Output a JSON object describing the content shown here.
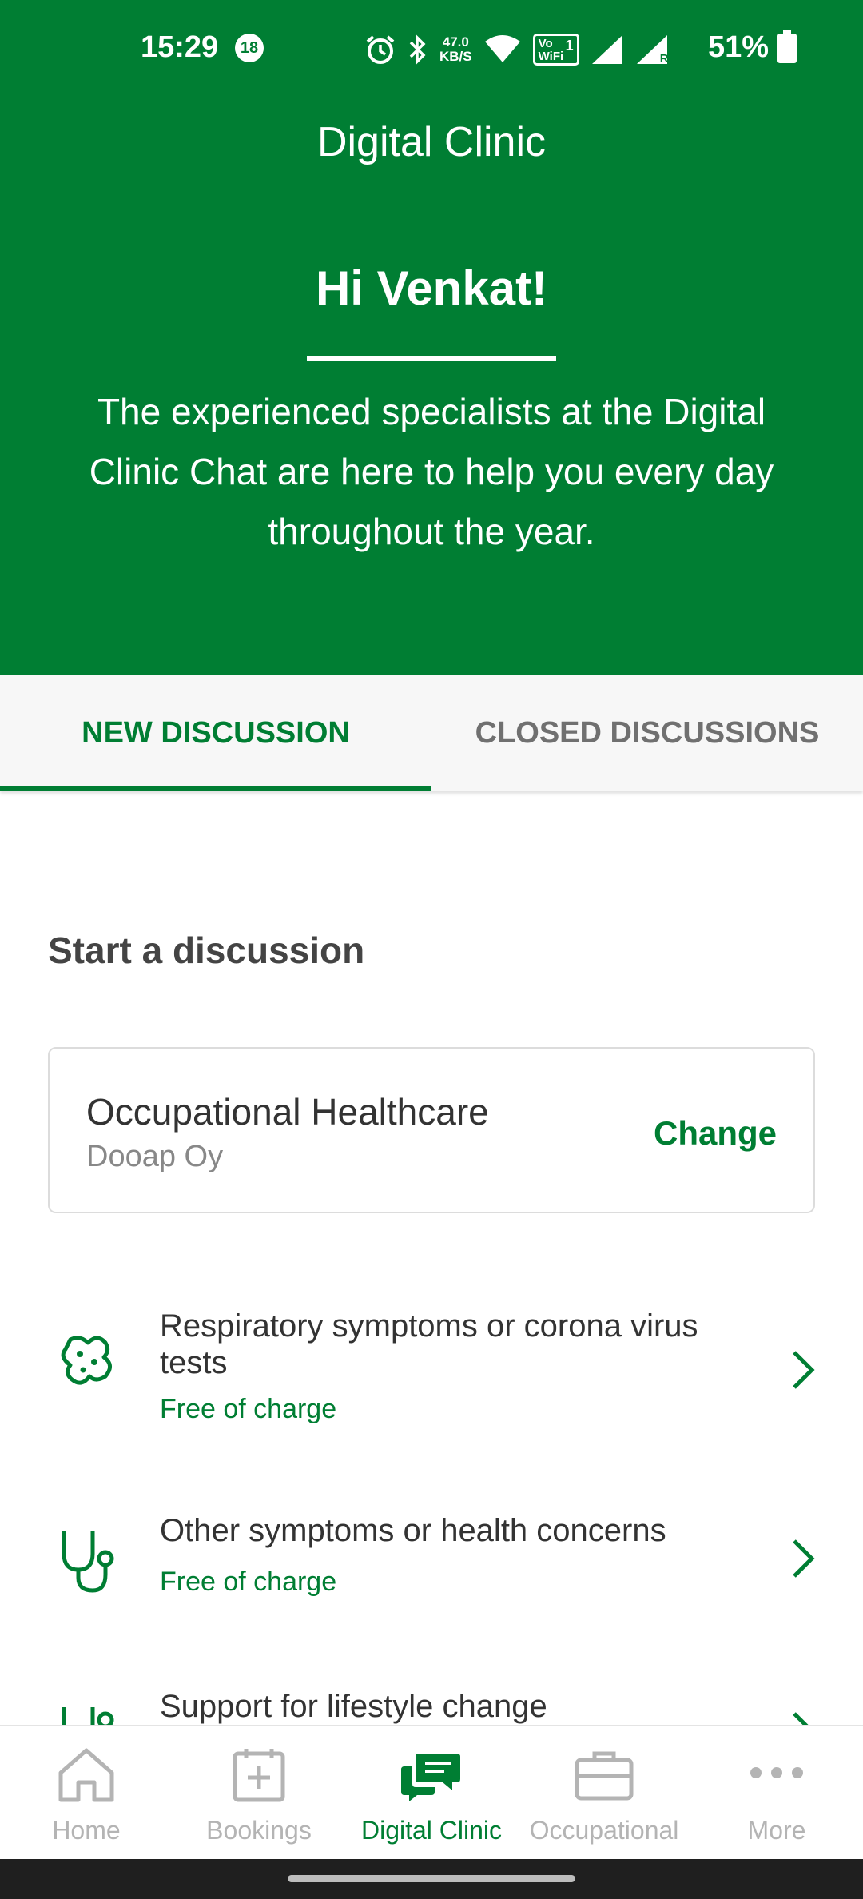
{
  "status_bar": {
    "time": "15:29",
    "notification_count": "18",
    "net_speed_value": "47.0",
    "net_speed_unit": "KB/S",
    "wifi_label_top": "Vo",
    "wifi_label_bottom": "WiFi",
    "wifi_number": "1",
    "roaming": "R",
    "battery_percent": "51%"
  },
  "header": {
    "app_title": "Digital Clinic",
    "greeting": "Hi Venkat!",
    "intro_text": "The experienced specialists at the Digital Clinic Chat are here to help you every day throughout the year."
  },
  "tabs": [
    {
      "label": "NEW DISCUSSION",
      "active": true
    },
    {
      "label": "CLOSED DISCUSSIONS",
      "active": false
    }
  ],
  "main": {
    "section_title": "Start a discussion",
    "service_card": {
      "title": "Occupational Healthcare",
      "subtitle": "Dooap Oy",
      "action_label": "Change"
    },
    "options": [
      {
        "icon": "virus-icon",
        "title": "Respiratory symptoms or corona virus tests",
        "price": "Free of charge"
      },
      {
        "icon": "stethoscope-icon",
        "title": "Other symptoms or health concerns",
        "price": "Free of charge"
      },
      {
        "icon": "stethoscope-icon",
        "title": "Support for lifestyle change",
        "price": ""
      }
    ]
  },
  "bottom_nav": [
    {
      "label": "Home",
      "icon": "home-icon",
      "active": false
    },
    {
      "label": "Bookings",
      "icon": "calendar-add-icon",
      "active": false
    },
    {
      "label": "Digital Clinic",
      "icon": "chat-bubbles-icon",
      "active": true
    },
    {
      "label": "Occupational",
      "icon": "briefcase-icon",
      "active": false
    },
    {
      "label": "More",
      "icon": "more-dots-icon",
      "active": false
    }
  ],
  "colors": {
    "brand_green": "#007e33",
    "inactive_gray": "#b4b4b4",
    "text_dark": "#333333"
  }
}
